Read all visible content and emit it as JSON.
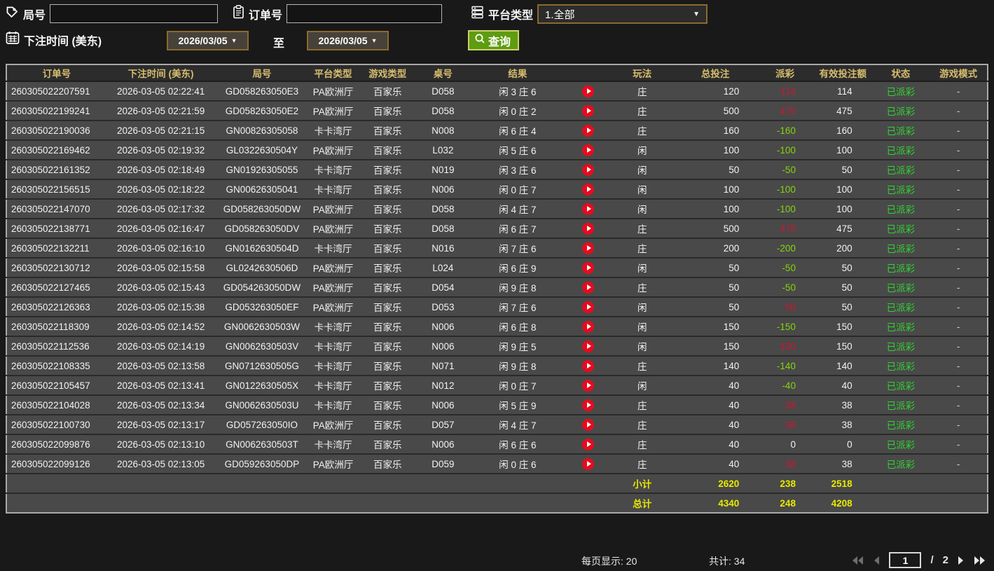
{
  "topbar": {
    "round_label": "局号",
    "round_input_value": "",
    "order_label": "订单号",
    "order_input_value": "",
    "platform_label": "平台类型",
    "platform_value": "1.全部",
    "bet_time_label": "下注时间 (美东)",
    "date_from": "2026/03/05",
    "to_label": "至",
    "date_to": "2026/03/05",
    "search_label": "查询"
  },
  "table": {
    "headers": [
      "订单号",
      "下注时间 (美东)",
      "局号",
      "平台类型",
      "游戏类型",
      "桌号",
      "结果",
      "",
      "玩法",
      "总投注",
      "派彩",
      "有效投注额",
      "状态",
      "游戏模式"
    ],
    "rows": [
      {
        "order": "260305022207591",
        "time": "2026-03-05 02:22:41",
        "round": "GD058263050E3",
        "platform": "PA欧洲厅",
        "game": "百家乐",
        "table": "D058",
        "result": "闲 3 庄 6",
        "bet": "庄",
        "total": "120",
        "payout": "114",
        "payout_sign": "win",
        "valid": "114",
        "status": "已派彩",
        "mode": "-"
      },
      {
        "order": "260305022199241",
        "time": "2026-03-05 02:21:59",
        "round": "GD058263050E2",
        "platform": "PA欧洲厅",
        "game": "百家乐",
        "table": "D058",
        "result": "闲 0 庄 2",
        "bet": "庄",
        "total": "500",
        "payout": "475",
        "payout_sign": "win",
        "valid": "475",
        "status": "已派彩",
        "mode": "-"
      },
      {
        "order": "260305022190036",
        "time": "2026-03-05 02:21:15",
        "round": "GN00826305058",
        "platform": "卡卡湾厅",
        "game": "百家乐",
        "table": "N008",
        "result": "闲 6 庄 4",
        "bet": "庄",
        "total": "160",
        "payout": "-160",
        "payout_sign": "loss",
        "valid": "160",
        "status": "已派彩",
        "mode": "-"
      },
      {
        "order": "260305022169462",
        "time": "2026-03-05 02:19:32",
        "round": "GL0322630504Y",
        "platform": "PA欧洲厅",
        "game": "百家乐",
        "table": "L032",
        "result": "闲 5 庄 6",
        "bet": "闲",
        "total": "100",
        "payout": "-100",
        "payout_sign": "loss",
        "valid": "100",
        "status": "已派彩",
        "mode": "-"
      },
      {
        "order": "260305022161352",
        "time": "2026-03-05 02:18:49",
        "round": "GN01926305055",
        "platform": "卡卡湾厅",
        "game": "百家乐",
        "table": "N019",
        "result": "闲 3 庄 6",
        "bet": "闲",
        "total": "50",
        "payout": "-50",
        "payout_sign": "loss",
        "valid": "50",
        "status": "已派彩",
        "mode": "-"
      },
      {
        "order": "260305022156515",
        "time": "2026-03-05 02:18:22",
        "round": "GN00626305041",
        "platform": "卡卡湾厅",
        "game": "百家乐",
        "table": "N006",
        "result": "闲 0 庄 7",
        "bet": "闲",
        "total": "100",
        "payout": "-100",
        "payout_sign": "loss",
        "valid": "100",
        "status": "已派彩",
        "mode": "-"
      },
      {
        "order": "260305022147070",
        "time": "2026-03-05 02:17:32",
        "round": "GD058263050DW",
        "platform": "PA欧洲厅",
        "game": "百家乐",
        "table": "D058",
        "result": "闲 4 庄 7",
        "bet": "闲",
        "total": "100",
        "payout": "-100",
        "payout_sign": "loss",
        "valid": "100",
        "status": "已派彩",
        "mode": "-"
      },
      {
        "order": "260305022138771",
        "time": "2026-03-05 02:16:47",
        "round": "GD058263050DV",
        "platform": "PA欧洲厅",
        "game": "百家乐",
        "table": "D058",
        "result": "闲 6 庄 7",
        "bet": "庄",
        "total": "500",
        "payout": "475",
        "payout_sign": "win",
        "valid": "475",
        "status": "已派彩",
        "mode": "-"
      },
      {
        "order": "260305022132211",
        "time": "2026-03-05 02:16:10",
        "round": "GN0162630504D",
        "platform": "卡卡湾厅",
        "game": "百家乐",
        "table": "N016",
        "result": "闲 7 庄 6",
        "bet": "庄",
        "total": "200",
        "payout": "-200",
        "payout_sign": "loss",
        "valid": "200",
        "status": "已派彩",
        "mode": "-"
      },
      {
        "order": "260305022130712",
        "time": "2026-03-05 02:15:58",
        "round": "GL0242630506D",
        "platform": "PA欧洲厅",
        "game": "百家乐",
        "table": "L024",
        "result": "闲 6 庄 9",
        "bet": "闲",
        "total": "50",
        "payout": "-50",
        "payout_sign": "loss",
        "valid": "50",
        "status": "已派彩",
        "mode": "-"
      },
      {
        "order": "260305022127465",
        "time": "2026-03-05 02:15:43",
        "round": "GD054263050DW",
        "platform": "PA欧洲厅",
        "game": "百家乐",
        "table": "D054",
        "result": "闲 9 庄 8",
        "bet": "庄",
        "total": "50",
        "payout": "-50",
        "payout_sign": "loss",
        "valid": "50",
        "status": "已派彩",
        "mode": "-"
      },
      {
        "order": "260305022126363",
        "time": "2026-03-05 02:15:38",
        "round": "GD053263050EF",
        "platform": "PA欧洲厅",
        "game": "百家乐",
        "table": "D053",
        "result": "闲 7 庄 6",
        "bet": "闲",
        "total": "50",
        "payout": "50",
        "payout_sign": "win",
        "valid": "50",
        "status": "已派彩",
        "mode": "-"
      },
      {
        "order": "260305022118309",
        "time": "2026-03-05 02:14:52",
        "round": "GN0062630503W",
        "platform": "卡卡湾厅",
        "game": "百家乐",
        "table": "N006",
        "result": "闲 6 庄 8",
        "bet": "闲",
        "total": "150",
        "payout": "-150",
        "payout_sign": "loss",
        "valid": "150",
        "status": "已派彩",
        "mode": "-"
      },
      {
        "order": "260305022112536",
        "time": "2026-03-05 02:14:19",
        "round": "GN0062630503V",
        "platform": "卡卡湾厅",
        "game": "百家乐",
        "table": "N006",
        "result": "闲 9 庄 5",
        "bet": "闲",
        "total": "150",
        "payout": "150",
        "payout_sign": "win",
        "valid": "150",
        "status": "已派彩",
        "mode": "-"
      },
      {
        "order": "260305022108335",
        "time": "2026-03-05 02:13:58",
        "round": "GN0712630505G",
        "platform": "卡卡湾厅",
        "game": "百家乐",
        "table": "N071",
        "result": "闲 9 庄 8",
        "bet": "庄",
        "total": "140",
        "payout": "-140",
        "payout_sign": "loss",
        "valid": "140",
        "status": "已派彩",
        "mode": "-"
      },
      {
        "order": "260305022105457",
        "time": "2026-03-05 02:13:41",
        "round": "GN0122630505X",
        "platform": "卡卡湾厅",
        "game": "百家乐",
        "table": "N012",
        "result": "闲 0 庄 7",
        "bet": "闲",
        "total": "40",
        "payout": "-40",
        "payout_sign": "loss",
        "valid": "40",
        "status": "已派彩",
        "mode": "-"
      },
      {
        "order": "260305022104028",
        "time": "2026-03-05 02:13:34",
        "round": "GN0062630503U",
        "platform": "卡卡湾厅",
        "game": "百家乐",
        "table": "N006",
        "result": "闲 5 庄 9",
        "bet": "庄",
        "total": "40",
        "payout": "38",
        "payout_sign": "win",
        "valid": "38",
        "status": "已派彩",
        "mode": "-"
      },
      {
        "order": "260305022100730",
        "time": "2026-03-05 02:13:17",
        "round": "GD057263050IO",
        "platform": "PA欧洲厅",
        "game": "百家乐",
        "table": "D057",
        "result": "闲 4 庄 7",
        "bet": "庄",
        "total": "40",
        "payout": "38",
        "payout_sign": "win",
        "valid": "38",
        "status": "已派彩",
        "mode": "-"
      },
      {
        "order": "260305022099876",
        "time": "2026-03-05 02:13:10",
        "round": "GN0062630503T",
        "platform": "卡卡湾厅",
        "game": "百家乐",
        "table": "N006",
        "result": "闲 6 庄 6",
        "bet": "庄",
        "total": "40",
        "payout": "0",
        "payout_sign": "zero",
        "valid": "0",
        "status": "已派彩",
        "mode": "-"
      },
      {
        "order": "260305022099126",
        "time": "2026-03-05 02:13:05",
        "round": "GD059263050DP",
        "platform": "PA欧洲厅",
        "game": "百家乐",
        "table": "D059",
        "result": "闲 0 庄 6",
        "bet": "庄",
        "total": "40",
        "payout": "38",
        "payout_sign": "win",
        "valid": "38",
        "status": "已派彩",
        "mode": "-"
      }
    ],
    "subtotal": {
      "label": "小计",
      "total_bet": "2620",
      "payout": "238",
      "valid_bet": "2518"
    },
    "total": {
      "label": "总计",
      "total_bet": "4340",
      "payout": "248",
      "valid_bet": "4208"
    }
  },
  "footer": {
    "per_page": "每页显示: 20",
    "total_count": "共计: 34",
    "current_page": "1",
    "page_divider": "/",
    "total_pages": "2"
  },
  "colors": {
    "gold": "#d7bd6e",
    "win": "#cf1432",
    "loss": "#85d40c",
    "status_green": "#30d430",
    "summary_yellow": "#e9e900",
    "button_green": "#5e9c10",
    "play_red": "#e60b1e",
    "picker_border": "#8a6a2f"
  }
}
